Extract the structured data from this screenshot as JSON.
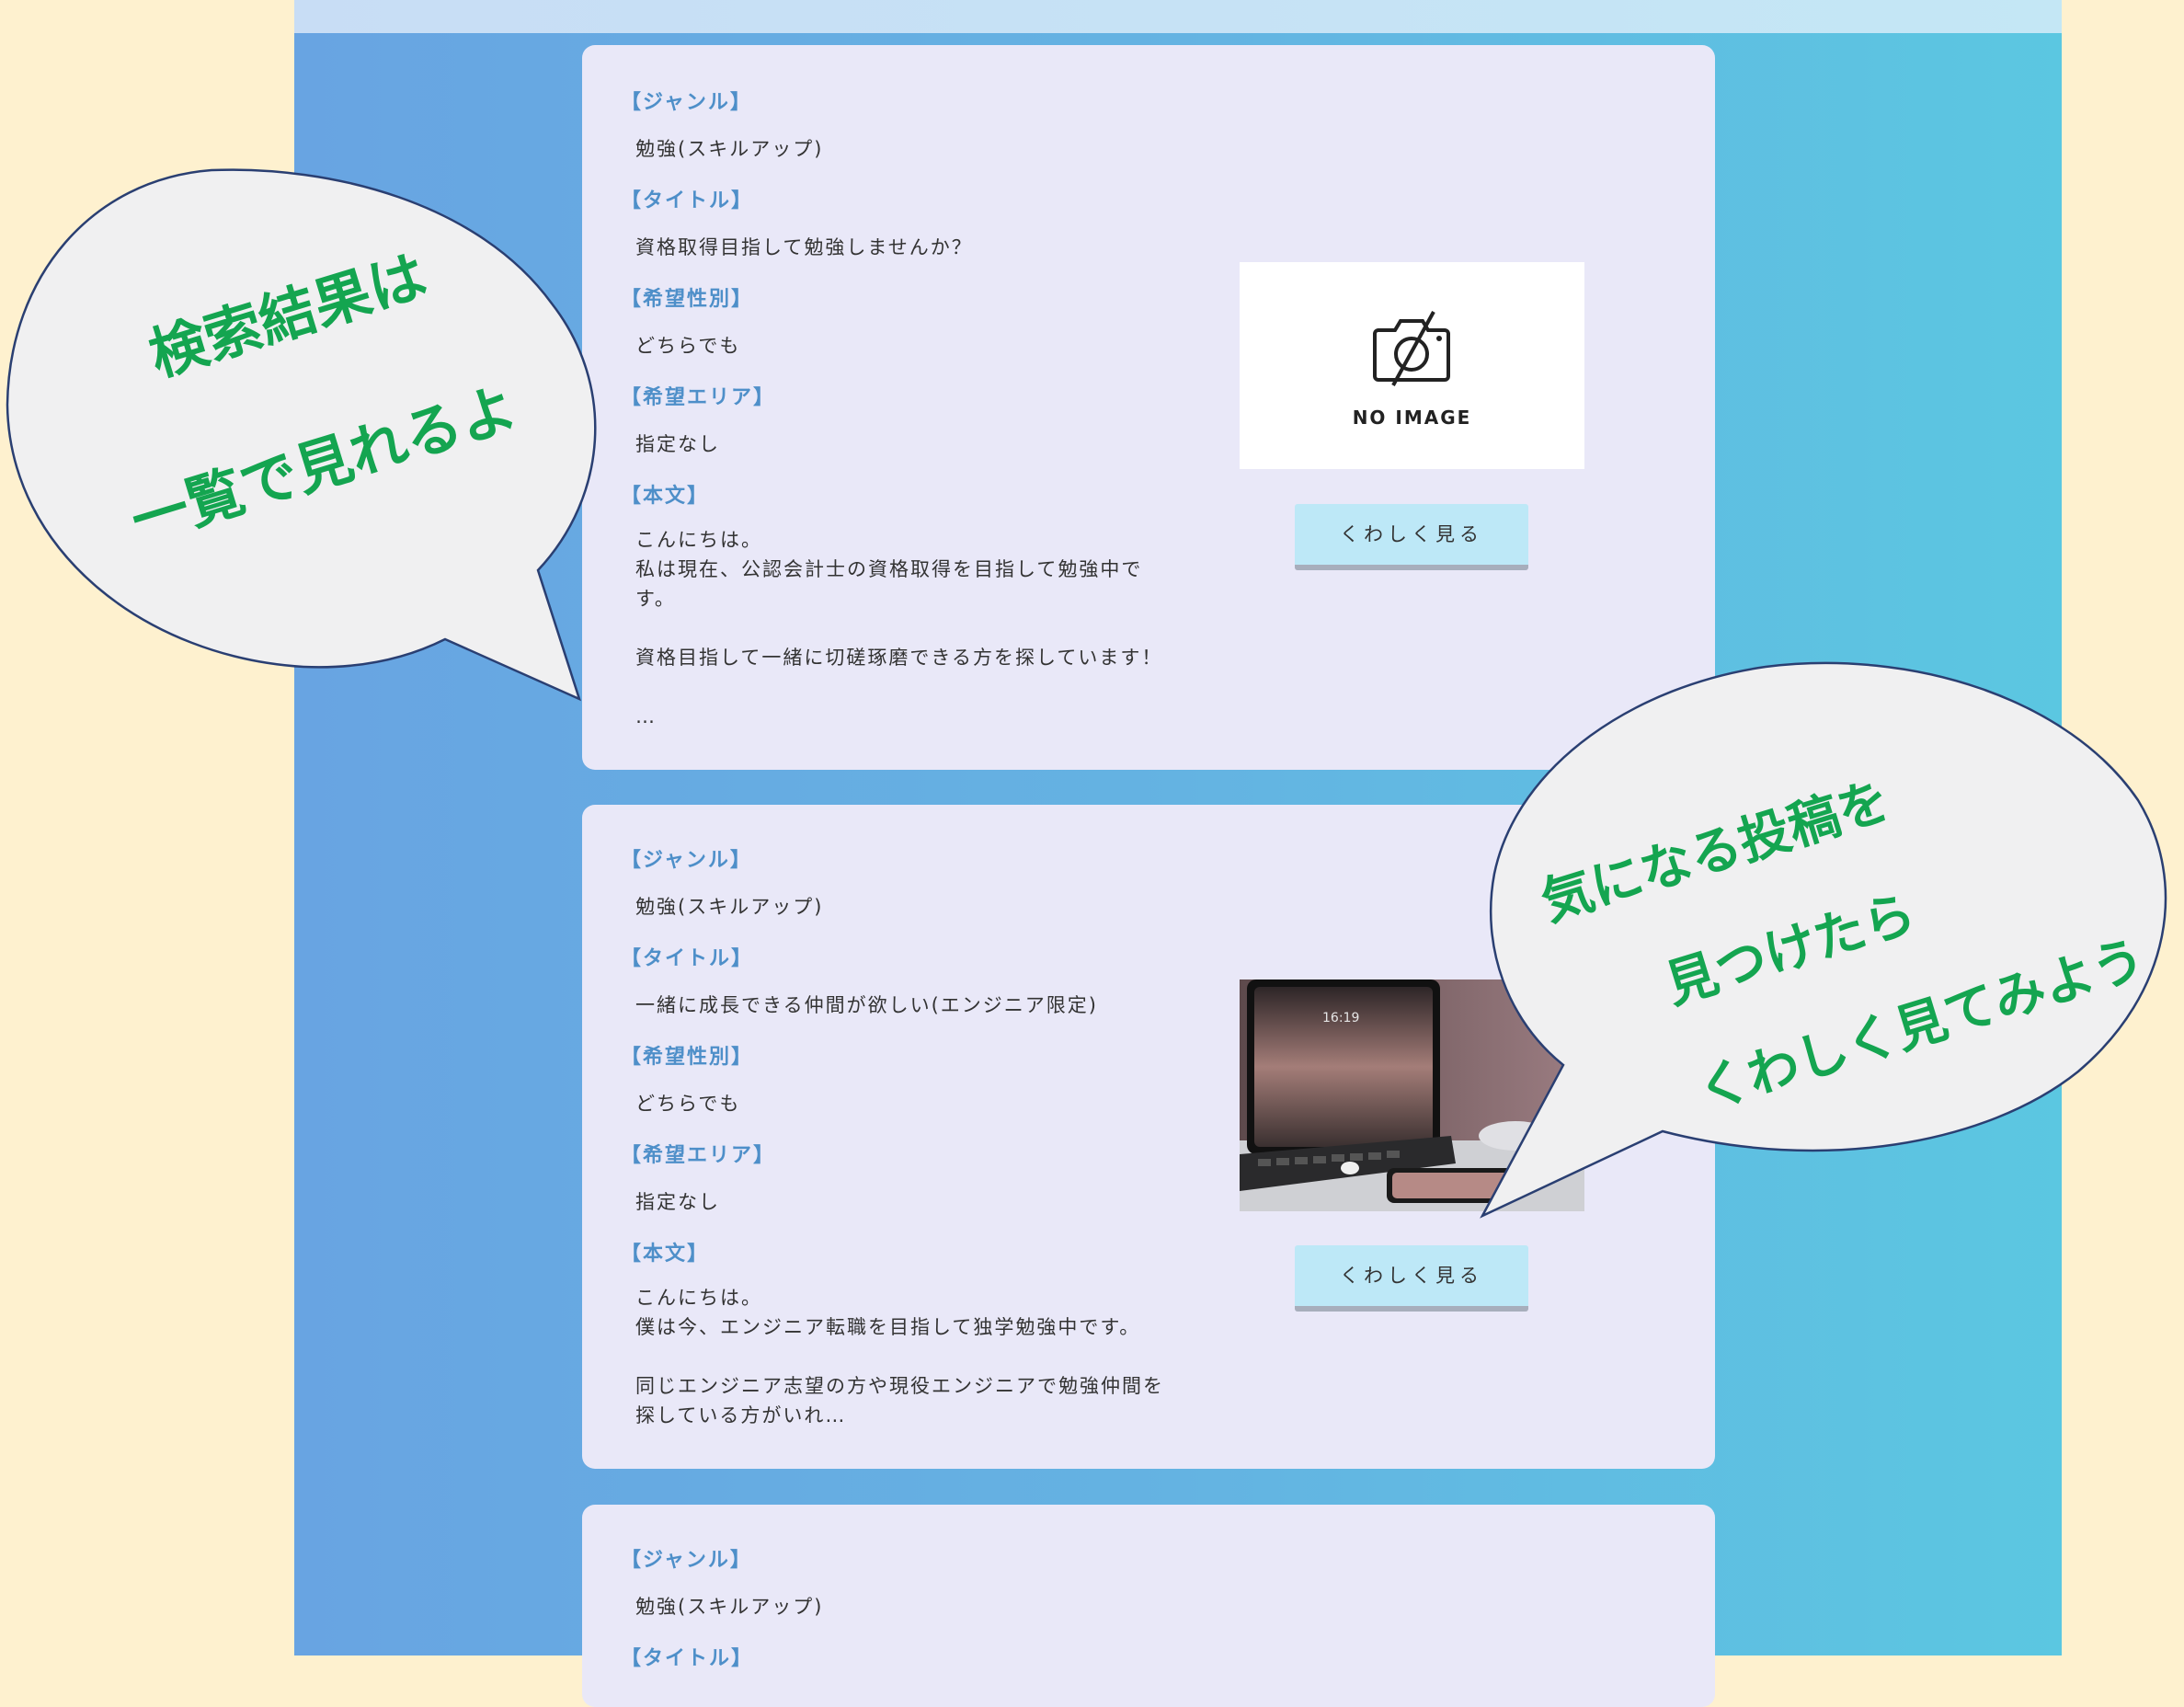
{
  "colors": {
    "page_bg": "#fef1cf",
    "frame_bg": "#64b3e2",
    "card_bg": "#e9e8f8",
    "label": "#4e8fc9",
    "button_bg": "#bde8f7",
    "bubble_text": "#14a550"
  },
  "labels": {
    "genre": "【ジャンル】",
    "title": "【タイトル】",
    "gender": "【希望性別】",
    "area": "【希望エリア】",
    "body": "【本文】"
  },
  "posts": [
    {
      "genre": "勉強(スキルアップ)",
      "title": "資格取得目指して勉強しませんか？",
      "gender": "どちらでも",
      "area": "指定なし",
      "body": "こんにちは。\n私は現在、公認会計士の資格取得を目指して勉強中で\nす。\n\n資格目指して一緒に切磋琢磨できる方を探しています！\n\n…",
      "image": "NO IMAGE",
      "button": "くわしく見る"
    },
    {
      "genre": "勉強(スキルアップ)",
      "title": "一緒に成長できる仲間が欲しい(エンジニア限定)",
      "gender": "どちらでも",
      "area": "指定なし",
      "body": "こんにちは。\n僕は今、エンジニア転職を目指して独学勉強中です。\n\n同じエンジニア志望の方や現役エンジニアで勉強仲間を\n探している方がいれ…",
      "phone_time": "16:19",
      "button": "くわしく見る"
    },
    {
      "genre": "勉強(スキルアップ)"
    }
  ],
  "bubbles": {
    "left_line1": "検索結果は",
    "left_line2": "一覧で見れるよ",
    "right_line1": "気になる投稿を",
    "right_line2": "見つけたら",
    "right_line3": "くわしく見てみよう"
  }
}
